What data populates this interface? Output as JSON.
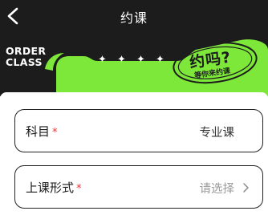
{
  "header": {
    "title": "约课"
  },
  "banner": {
    "line1": "ORDER",
    "line2": "CLASS",
    "badge_main": "约吗?",
    "badge_sub": "等你来约课",
    "accent_color": "#7de83a",
    "sparkles": [
      "✦",
      "✦",
      "✦",
      "✦"
    ]
  },
  "form": {
    "subject": {
      "label": "科目",
      "required": "*",
      "value": "专业课"
    },
    "mode": {
      "label": "上课形式",
      "required": "*",
      "placeholder": "请选择"
    }
  }
}
